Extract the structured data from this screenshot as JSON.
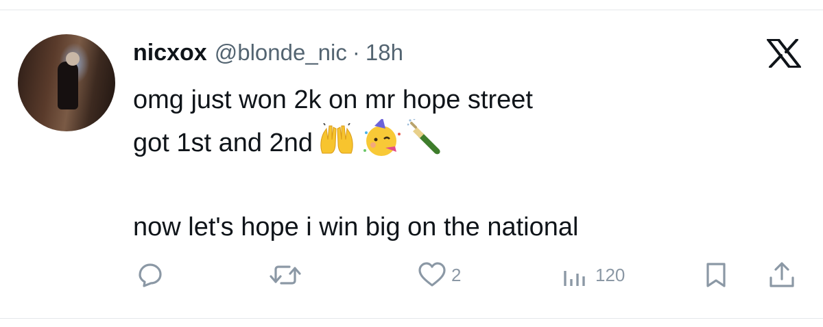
{
  "post": {
    "author_name": "nicxox",
    "author_handle": "@blonde_nic",
    "separator": "·",
    "time": "18h",
    "text_lines": [
      "omg just won 2k on mr hope street",
      "got 1st and 2nd",
      "now let's hope i win big on the national"
    ],
    "emojis": [
      "raising-hands-emoji",
      "partying-face-emoji",
      "champagne-emoji"
    ]
  },
  "actions": {
    "reply": {
      "icon": "reply-icon",
      "count": ""
    },
    "repost": {
      "icon": "repost-icon",
      "count": ""
    },
    "like": {
      "icon": "heart-icon",
      "count": "2"
    },
    "views": {
      "icon": "views-icon",
      "count": "120"
    },
    "bookmark": {
      "icon": "bookmark-icon"
    },
    "share": {
      "icon": "share-icon"
    }
  },
  "colors": {
    "text": "#0f1419",
    "muted": "#536471",
    "icon": "#8b98a5",
    "divider": "#e4e7ea"
  }
}
